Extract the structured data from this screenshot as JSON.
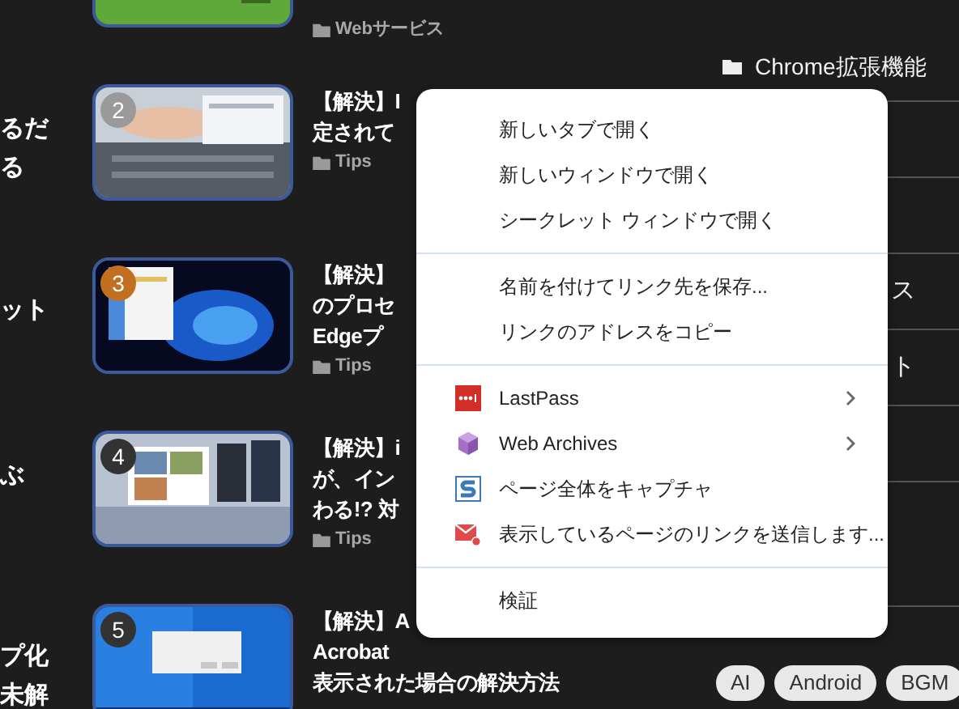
{
  "left_fragments": [
    "るだ",
    "る",
    "ット",
    "ぶ",
    "プ化",
    "未解"
  ],
  "articles": [
    {
      "category": "Webサービス"
    },
    {
      "rank": "2",
      "color": "#9a9a9a",
      "title_lines": [
        "【解決】I",
        "定されて"
      ],
      "category": "Tips"
    },
    {
      "rank": "3",
      "color": "#c07020",
      "title_lines": [
        "【解決】",
        "のプロセ",
        "Edgeプ"
      ],
      "category": "Tips"
    },
    {
      "rank": "4",
      "color": "#333333",
      "title_lines": [
        "【解決】i",
        "が、イン",
        "わる!? 対"
      ],
      "category": "Tips"
    },
    {
      "rank": "5",
      "color": "#333333",
      "title_lines": [
        "【解決】A",
        "Acrobat",
        "表示された場合の解決方法"
      ]
    }
  ],
  "sidebar": {
    "category": "Chrome拡張機能",
    "links": [
      {
        "text": "ス"
      },
      {
        "text": "ト"
      }
    ],
    "tags": [
      "AI",
      "Android",
      "BGM"
    ]
  },
  "context_menu": {
    "groups": [
      [
        {
          "label": "新しいタブで開く",
          "kind": "plain",
          "submenu": false
        },
        {
          "label": "新しいウィンドウで開く",
          "kind": "plain",
          "submenu": false
        },
        {
          "label": "シークレット ウィンドウで開く",
          "kind": "plain",
          "submenu": false
        }
      ],
      [
        {
          "label": "名前を付けてリンク先を保存...",
          "kind": "plain",
          "submenu": false
        },
        {
          "label": "リンクのアドレスをコピー",
          "kind": "plain",
          "submenu": false
        }
      ],
      [
        {
          "label": "LastPass",
          "kind": "dots",
          "submenu": true
        },
        {
          "label": "Web Archives",
          "kind": "cube",
          "submenu": true
        },
        {
          "label": "ページ全体をキャプチャ",
          "kind": "capture",
          "submenu": false
        },
        {
          "label": "表示しているページのリンクを送信します...",
          "kind": "mail",
          "submenu": false
        }
      ],
      [
        {
          "label": "検証",
          "kind": "plain",
          "submenu": false
        }
      ]
    ]
  }
}
